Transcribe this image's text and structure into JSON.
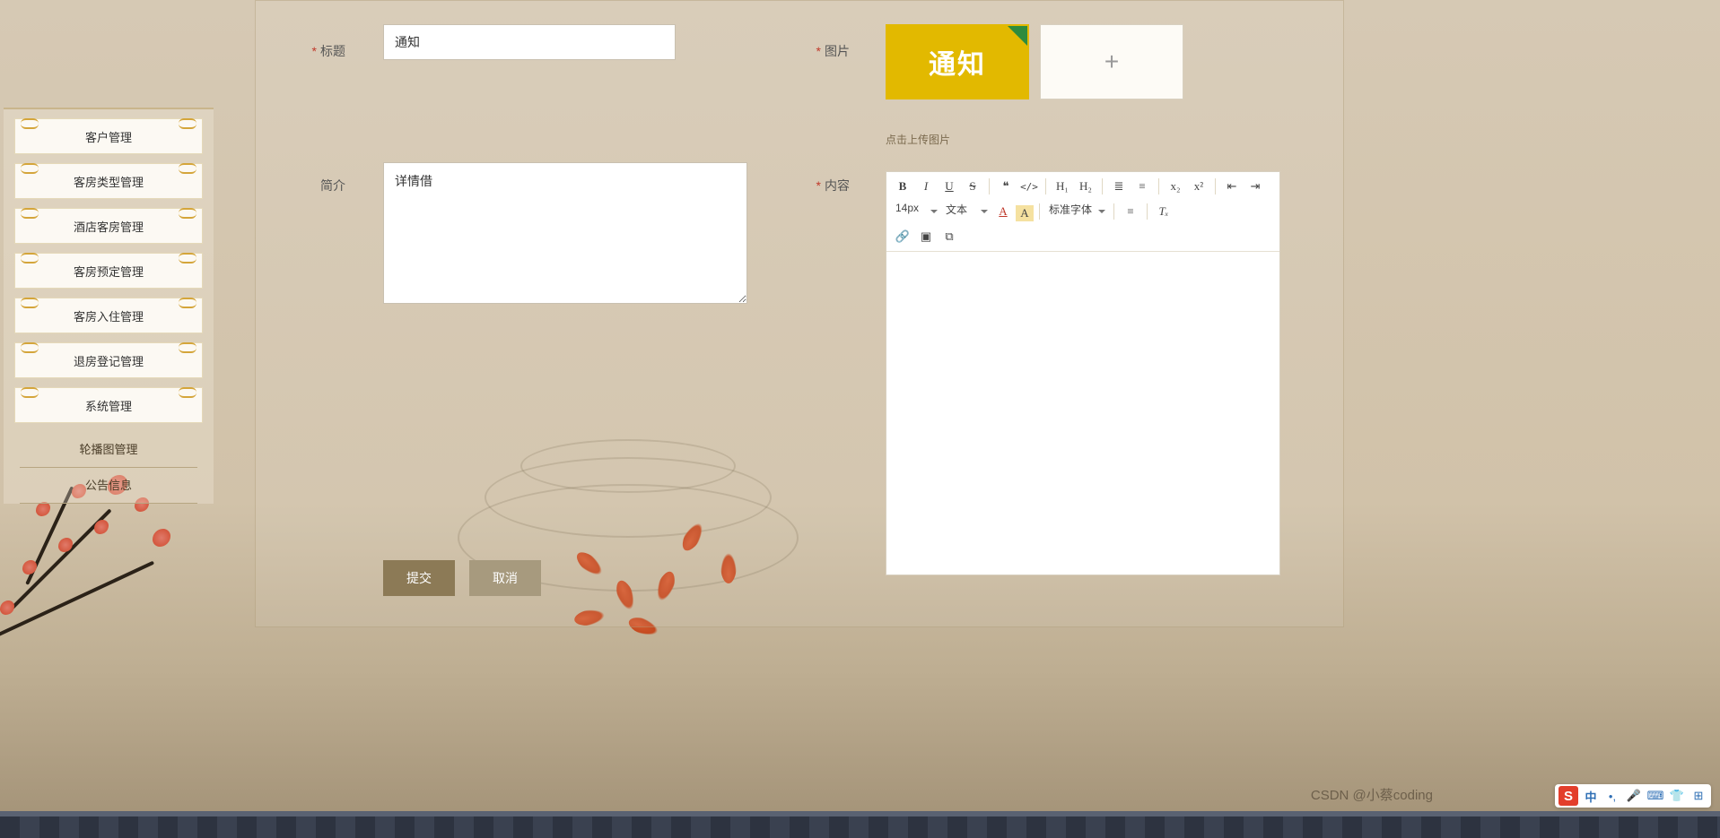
{
  "sidebar": {
    "items": [
      {
        "label": "客户管理"
      },
      {
        "label": "客房类型管理"
      },
      {
        "label": "酒店客房管理"
      },
      {
        "label": "客房预定管理"
      },
      {
        "label": "客房入住管理"
      },
      {
        "label": "退房登记管理"
      },
      {
        "label": "系统管理"
      }
    ],
    "subs": [
      {
        "label": "轮播图管理"
      },
      {
        "label": "公告信息"
      }
    ]
  },
  "form": {
    "title_label": "标题",
    "title_value": "通知",
    "image_label": "图片",
    "image_text": "通知",
    "image_add": "+",
    "image_hint": "点击上传图片",
    "intro_label": "简介",
    "intro_value": "详情借",
    "content_label": "内容",
    "submit": "提交",
    "cancel": "取消"
  },
  "editor": {
    "font_size": "14px",
    "font_kind": "文本",
    "font_family": "标准字体",
    "icons": {
      "bold": "B",
      "italic": "I",
      "underline": "U",
      "strike": "S",
      "quote": "❝",
      "code": "</>",
      "h1": "H₁",
      "h2": "H₂",
      "ol": "≣",
      "ul": "≡",
      "sub": "x₂",
      "sup": "x²",
      "indent_dec": "⇤",
      "indent_inc": "⇥",
      "font_color": "A",
      "bg_color": "A",
      "align": "≡",
      "clear": "Tₓ",
      "link": "🔗",
      "image": "▣",
      "video": "⧉"
    }
  },
  "footer": {
    "watermark": "CSDN @小蔡coding",
    "ime_logo": "S",
    "ime_lang": "中"
  }
}
